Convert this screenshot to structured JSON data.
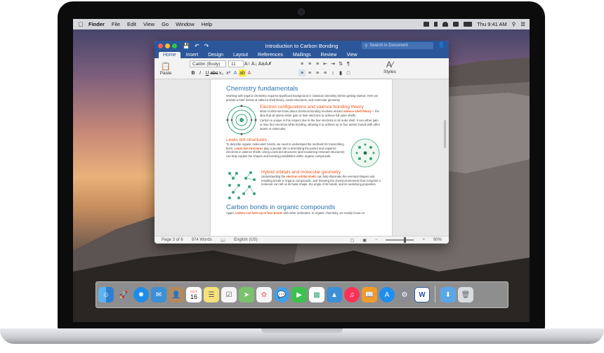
{
  "menubar": {
    "items": [
      "Finder",
      "File",
      "Edit",
      "View",
      "Go",
      "Window",
      "Help"
    ],
    "clock": "Thu 9:41 AM"
  },
  "window": {
    "title": "Introduction to Carbon Bonding",
    "search_placeholder": "Search in Document",
    "tabs": [
      "Home",
      "Insert",
      "Design",
      "Layout",
      "References",
      "Mailings",
      "Review",
      "View"
    ],
    "active_tab": "Home"
  },
  "ribbon": {
    "paste_label": "Paste",
    "font_name": "Calibri (Body)",
    "font_size": "11",
    "styles_label": "Styles"
  },
  "document": {
    "heading_main": "Chemistry fundamentals",
    "intro": "Working with organic chemistry requires significant background in classical chemistry before getting started. Here we provide a brief review of valence shell theory, Lewis structures, and molecular geometry.",
    "sections": [
      {
        "heading": "Electron configurations and valence bonding theory",
        "text_a": "Most of what we know about chemical bonding revolves around ",
        "highlight": "valence shell theory",
        "text_b": "— the idea that all atoms either gain or lose electrons to achieve full outer shells.",
        "text_c": "Carbon is unique in this respect due to the four electrons in its outer shell. It can either gain or lose four electrons while bonding, allowing it to achieve up to four atomic bonds with other atoms or molecules."
      },
      {
        "heading": "Lewis dot structures",
        "text_a": "To describe organic molecules' bonds, we need to understand the methods for transcribing them. ",
        "highlight": "Lewis dot structures",
        "text_b": " play a pivotal role in describing the paired and unpaired electrons in valence shells. Using Lewis dot structures (and examining resonant structures) can help explain the shapes and bonding possibilities within organic compounds."
      },
      {
        "heading": "Hybrid orbitals and molecular geometry",
        "text_a": "Understanding the ",
        "highlight": "electron orbital shells",
        "text_b": " can help illuminate the eventual shapes and resulting bonds in organic compounds. Just knowing the chemical elements that comprise a molecule can tell us its basic shape, the angle of its bonds, and its underlying properties."
      }
    ],
    "heading_bottom": "Carbon bonds in organic compounds",
    "bottom_text_a": "Again, ",
    "bottom_highlight": "carbon can form up to four bonds",
    "bottom_text_b": " with other molecules. In organic chemistry, we mainly focus on"
  },
  "status": {
    "page": "Page 3 of 6",
    "words": "974 Words",
    "language": "English (US)",
    "zoom": "90%"
  },
  "colors": {
    "word_blue": "#2b579a",
    "heading_blue": "#2e74b5",
    "accent_orange": "#e8581c"
  },
  "dock": {
    "apps": [
      "finder-icon",
      "launchpad-icon",
      "safari-icon",
      "mail-icon",
      "contacts-icon",
      "calendar-icon",
      "notes-icon",
      "reminders-icon",
      "maps-icon",
      "photos-icon",
      "messages-icon",
      "facetime-icon",
      "itunes-icon",
      "ibooks-icon",
      "appstore-icon",
      "system-preferences-icon",
      "word-icon"
    ],
    "calendar_month": "OCT",
    "calendar_day": "16"
  }
}
